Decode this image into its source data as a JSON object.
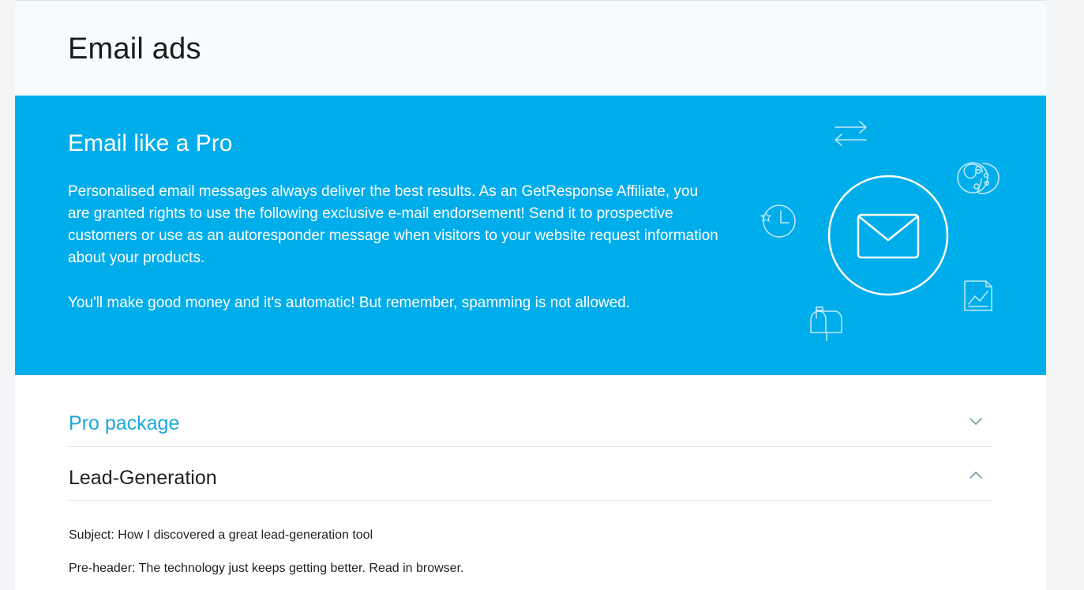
{
  "header": {
    "title": "Email ads"
  },
  "hero": {
    "title": "Email like a Pro",
    "paragraph1": "Personalised email messages always deliver the best results. As an GetResponse Affiliate, you are granted rights to use the following exclusive e-mail endorsement! Send it to prospective customers or use as an autoresponder message when visitors to your website request information about your products.",
    "paragraph2": "You'll make good money and it's automatic! But remember, spamming is not allowed.",
    "background_color": "#00adeb",
    "icons": [
      "envelope-icon",
      "arrows-exchange-icon",
      "palette-icon",
      "clock-icon",
      "chart-document-icon",
      "mailbox-icon"
    ]
  },
  "accordion": {
    "items": [
      {
        "label": "Pro package",
        "state": "collapsed",
        "icon": "chevron-down-icon"
      },
      {
        "label": "Lead-Generation",
        "state": "expanded",
        "icon": "chevron-up-icon"
      }
    ],
    "accent_color": "#1ba8dd"
  },
  "content": {
    "subject": "Subject: How I discovered a great lead-generation tool",
    "preheader": "Pre-header: The technology just keeps getting better. Read in browser."
  }
}
